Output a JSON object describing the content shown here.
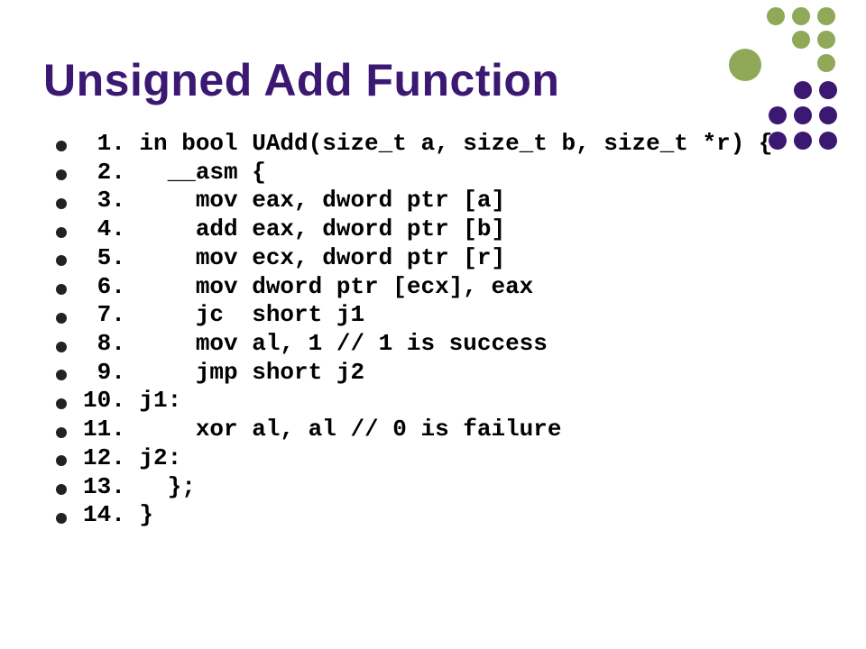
{
  "title": "Unsigned Add Function",
  "lines": [
    " 1. in bool UAdd(size_t a, size_t b, size_t *r) {",
    " 2.   __asm {",
    " 3.     mov eax, dword ptr [a]",
    " 4.     add eax, dword ptr [b]",
    " 5.     mov ecx, dword ptr [r]",
    " 6.     mov dword ptr [ecx], eax",
    " 7.     jc  short j1",
    " 8.     mov al, 1 // 1 is success",
    " 9.     jmp short j2",
    "10. j1:",
    "11.     xor al, al // 0 is failure",
    "12. j2:",
    "13.   };",
    "14. }"
  ],
  "colors": {
    "accent": "#3b1972",
    "lime": "#8fa959"
  }
}
